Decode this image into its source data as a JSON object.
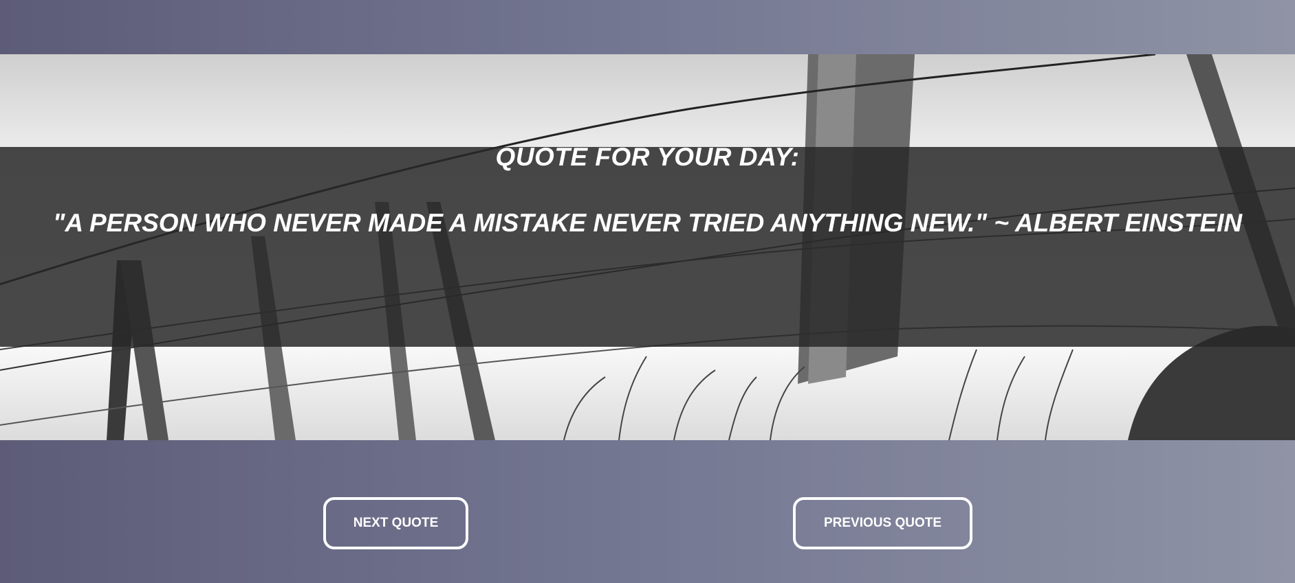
{
  "quote": {
    "heading": "QUOTE FOR YOUR DAY:",
    "text": "\"A PERSON WHO NEVER MADE A MISTAKE NEVER TRIED ANYTHING NEW.\" ~ ALBERT EINSTEIN"
  },
  "buttons": {
    "next_label": "NEXT QUOTE",
    "previous_label": "PREVIOUS QUOTE"
  },
  "colors": {
    "background_left": "#5d5c78",
    "background_right": "#8f93a5",
    "overlay_band": "#282828",
    "text": "#ffffff"
  },
  "background_image": "barbed-wire-fence-photo"
}
